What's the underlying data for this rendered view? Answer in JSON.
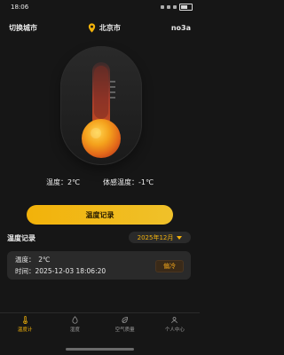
{
  "status_bar": {
    "time": "18:06"
  },
  "header": {
    "left": "切换城市",
    "city": "北京市",
    "user": "no3a"
  },
  "readout": {
    "temp_label": "温度：2℃",
    "feel_label": "体感温度：-1℃"
  },
  "actions": {
    "record_button": "温度记录"
  },
  "records": {
    "title": "温度记录",
    "month_selector": "2025年12月",
    "items": [
      {
        "temp_line": "温度：　2℃",
        "time_line": "时间：2025-12-03 18:06:20",
        "badge": "偏冷"
      }
    ]
  },
  "bottom_nav": {
    "items": [
      {
        "label": "温度计",
        "icon": "thermometer-icon",
        "active": true
      },
      {
        "label": "湿度",
        "icon": "droplet-icon",
        "active": false
      },
      {
        "label": "空气质量",
        "icon": "leaf-icon",
        "active": false
      },
      {
        "label": "个人中心",
        "icon": "user-icon",
        "active": false
      }
    ]
  },
  "colors": {
    "accent": "#f2b20a",
    "background": "#161616",
    "card": "#2a2a2a"
  }
}
